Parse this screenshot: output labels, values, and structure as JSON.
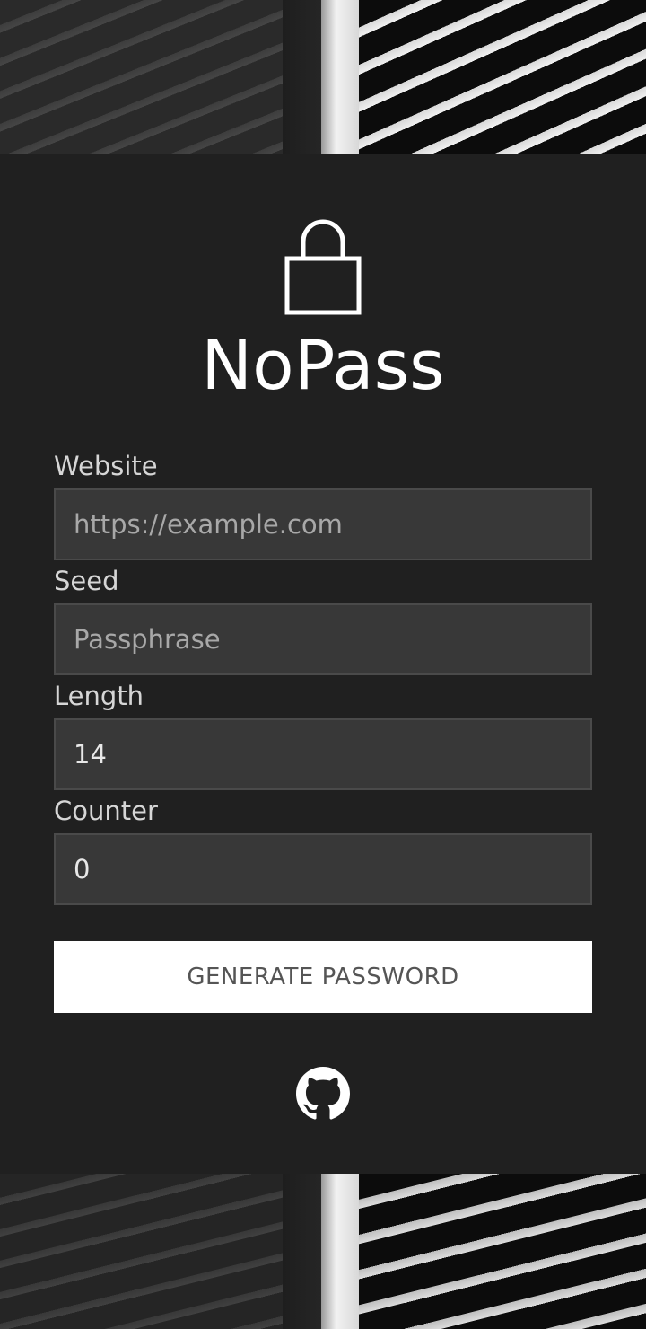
{
  "app": {
    "title": "NoPass"
  },
  "form": {
    "website_label": "Website",
    "website_placeholder": "https://example.com",
    "website_value": "",
    "seed_label": "Seed",
    "seed_placeholder": "Passphrase",
    "seed_value": "",
    "length_label": "Length",
    "length_value": "14",
    "counter_label": "Counter",
    "counter_value": "0",
    "generate_label": "GENERATE PASSWORD"
  },
  "icons": {
    "lock": "lock-icon",
    "github": "github-icon"
  },
  "colors": {
    "card_background": "#202020",
    "input_background": "#383838",
    "button_background": "#ffffff",
    "text": "#ffffff"
  }
}
